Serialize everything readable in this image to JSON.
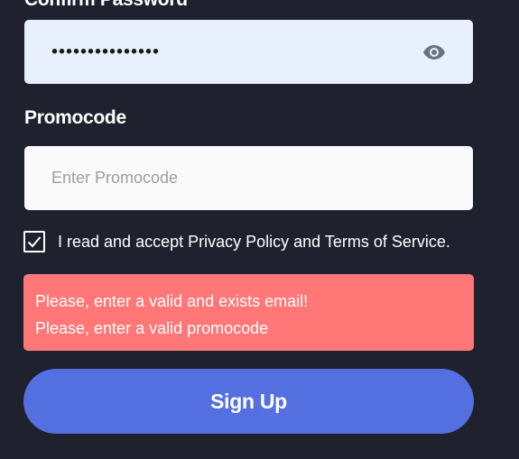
{
  "confirm_password": {
    "label": "Confirm Password",
    "value": "•••••••••••••••",
    "toggle_icon": "eye-icon"
  },
  "promocode": {
    "label": "Promocode",
    "placeholder": "Enter Promocode",
    "value": ""
  },
  "terms": {
    "checked": true,
    "text": "I read and accept Privacy Policy and Terms of Service.",
    "checkbox_icon": "checkmark-icon"
  },
  "errors": [
    "Please, enter a valid and exists email!",
    "Please, enter a valid promocode"
  ],
  "signup_button": {
    "label": "Sign Up",
    "color": "#5470e0"
  },
  "colors": {
    "background": "#1f212f",
    "error_background": "#ff7777",
    "autofill_field": "#e8f0fe"
  }
}
